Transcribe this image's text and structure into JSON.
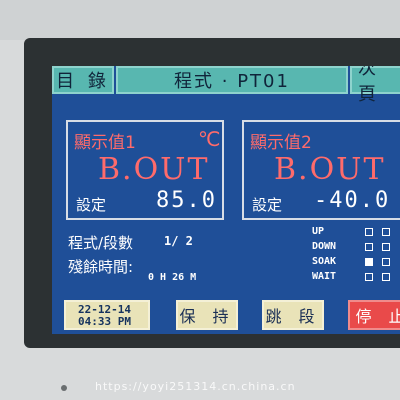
{
  "header": {
    "menu_button": "目 錄",
    "title": "程式 · PT01",
    "next_button": "次 頁"
  },
  "panel1": {
    "name": "顯示值1",
    "unit": "℃",
    "value": "B.OUT",
    "set_label": "設定",
    "set_value": "85.0"
  },
  "panel2": {
    "name": "顯示值2",
    "unit": "℃",
    "value": "B.OUT",
    "set_label": "設定",
    "set_value": "-40.0"
  },
  "program": {
    "segment_label": "程式/段數",
    "segment_value": "1/ 2",
    "remaining_label": "殘餘時間:",
    "remaining_value": "0 H 26 M"
  },
  "status": [
    {
      "label": "UP",
      "indicators": [
        false,
        false
      ]
    },
    {
      "label": "DOWN",
      "indicators": [
        false,
        false
      ]
    },
    {
      "label": "SOAK",
      "indicators": [
        true,
        false
      ]
    },
    {
      "label": "WAIT",
      "indicators": [
        false,
        false
      ]
    }
  ],
  "footer": {
    "date": "22-12-14",
    "time": "04:33 PM",
    "hold_button": "保 持",
    "skip_button": "跳 段",
    "stop_button": "停 止"
  },
  "watermark": "https://yoyi251314.cn.china.cn"
}
